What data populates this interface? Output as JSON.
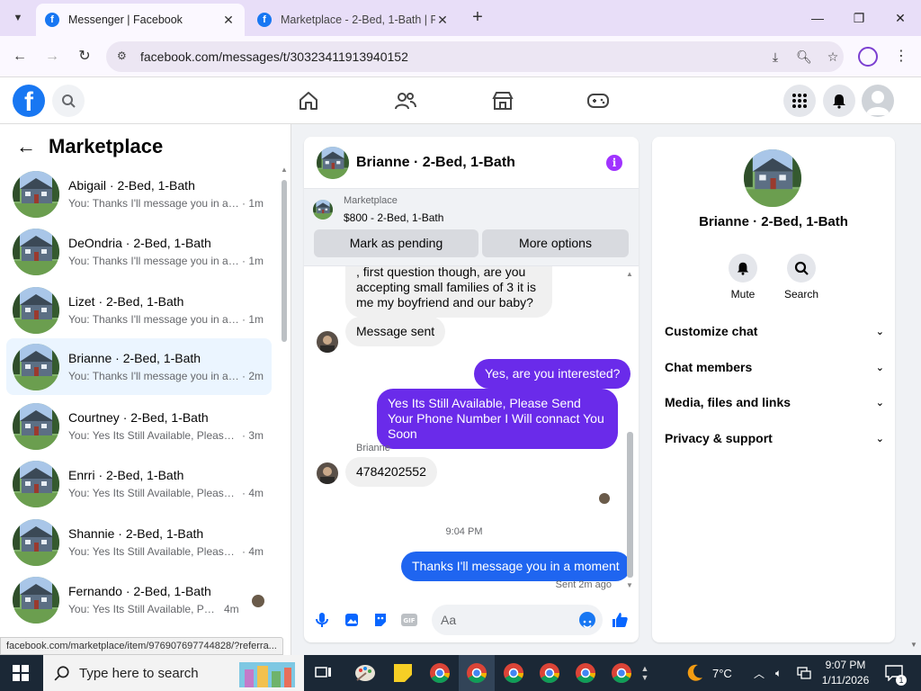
{
  "browser": {
    "tabs": [
      {
        "title": "Messenger | Facebook",
        "active": true
      },
      {
        "title": "Marketplace - 2-Bed, 1-Bath | Fa",
        "active": false
      }
    ],
    "url": "facebook.com/messages/t/30323411913940152",
    "status_url": "facebook.com/marketplace/item/976907697744828/?referra..."
  },
  "left": {
    "title": "Marketplace",
    "conversations": [
      {
        "name": "Abigail · 2-Bed, 1-Bath",
        "preview": "You: Thanks I'll message you in a ...",
        "time": "· 1m",
        "selected": false
      },
      {
        "name": "DeOndria · 2-Bed, 1-Bath",
        "preview": "You: Thanks I'll message you in a ...",
        "time": "· 1m",
        "selected": false
      },
      {
        "name": "Lizet · 2-Bed, 1-Bath",
        "preview": "You: Thanks I'll message you in a ...",
        "time": "· 1m",
        "selected": false
      },
      {
        "name": "Brianne · 2-Bed, 1-Bath",
        "preview": "You: Thanks I'll message you in a ...",
        "time": "· 2m",
        "selected": true
      },
      {
        "name": "Courtney · 2-Bed, 1-Bath",
        "preview": "You: Yes Its Still Available, Please S...",
        "time": "· 3m",
        "selected": false
      },
      {
        "name": "Enrri · 2-Bed, 1-Bath",
        "preview": "You: Yes Its Still Available, Please S...",
        "time": "· 4m",
        "selected": false
      },
      {
        "name": "Shannie · 2-Bed, 1-Bath",
        "preview": "You: Yes Its Still Available, Please S...",
        "time": "· 4m",
        "selected": false
      },
      {
        "name": "Fernando · 2-Bed, 1-Bath",
        "preview": "You: Yes Its Still Available, Pleas...",
        "time": "4m",
        "selected": false
      }
    ]
  },
  "chat": {
    "title": "Brianne · 2-Bed, 1-Bath",
    "info_icon": "i",
    "marketplace_label": "Marketplace",
    "listing": "$800 - 2-Bed, 1-Bath",
    "mark_pending": "Mark as pending",
    "more_options": "More options",
    "messages": {
      "m1": ", first question though, are you accepting small families of 3 it is me my boyfriend and our baby?",
      "m2": "Message sent",
      "m3": "Yes, are you interested?",
      "m4": "Yes Its Still Available, Please Send Your Phone Number I Will connact You Soon",
      "sender": "Brianne",
      "m5": "4784202552",
      "time_sep": "9:04 PM",
      "m6": "Thanks I'll message you in a moment",
      "sent_label": "Sent 2m ago"
    },
    "composer_placeholder": "Aa"
  },
  "right": {
    "name": "Brianne · 2-Bed, 1-Bath",
    "mute": "Mute",
    "search": "Search",
    "sections": [
      "Customize chat",
      "Chat members",
      "Media, files and links",
      "Privacy & support"
    ]
  },
  "taskbar": {
    "search_placeholder": "Type here to search",
    "weather": "7°C",
    "time": "9:07 PM",
    "date": "1/11/2026",
    "notifications": "1"
  }
}
